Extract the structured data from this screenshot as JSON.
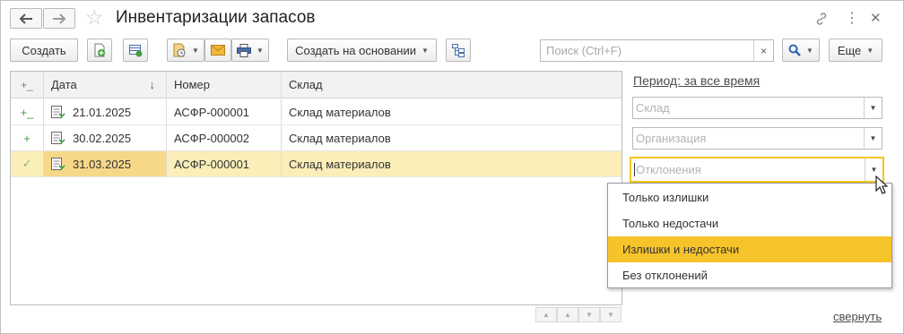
{
  "window": {
    "title": "Инвентаризации запасов",
    "back_icon": "arrow-left-icon",
    "forward_icon": "arrow-right-icon",
    "favorite_icon": "star-icon",
    "link_icon": "link-icon",
    "more_icon": "more-vertical-icon",
    "close_icon": "close-icon"
  },
  "toolbar": {
    "create_label": "Создать",
    "create_based_on_label": "Создать на основании",
    "more_label": "Еще",
    "search": {
      "placeholder": "Поиск (Ctrl+F)",
      "value": "",
      "clear_glyph": "×"
    }
  },
  "table": {
    "columns": [
      "Дата",
      "Номер",
      "Склад"
    ],
    "sort_glyph": "↓",
    "rows": [
      {
        "mark": "+_",
        "date": "21.01.2025",
        "number": "АСФР-000001",
        "warehouse": "Склад материалов",
        "selected": false
      },
      {
        "mark": "+",
        "date": "30.02.2025",
        "number": "АСФР-000002",
        "warehouse": "Склад материалов",
        "selected": false
      },
      {
        "mark": "✓",
        "date": "31.03.2025",
        "number": "АСФР-000001",
        "warehouse": "Склад материалов",
        "selected": true
      }
    ]
  },
  "filters": {
    "period_label": "Период: за все время",
    "warehouse_placeholder": "Склад",
    "organization_placeholder": "Организация",
    "deviations_placeholder": "Отклонения",
    "deviations_options": [
      "Только излишки",
      "Только недостачи",
      "Излишки и недостачи",
      "Без отклонений"
    ],
    "highlighted_option": "Излишки и недостачи",
    "collapse_label": "свернуть"
  },
  "colors": {
    "accent": "#f6c32a",
    "selected_row": "#fbeeb9",
    "selected_cell": "#f7d889",
    "status_green": "#3da13d"
  }
}
